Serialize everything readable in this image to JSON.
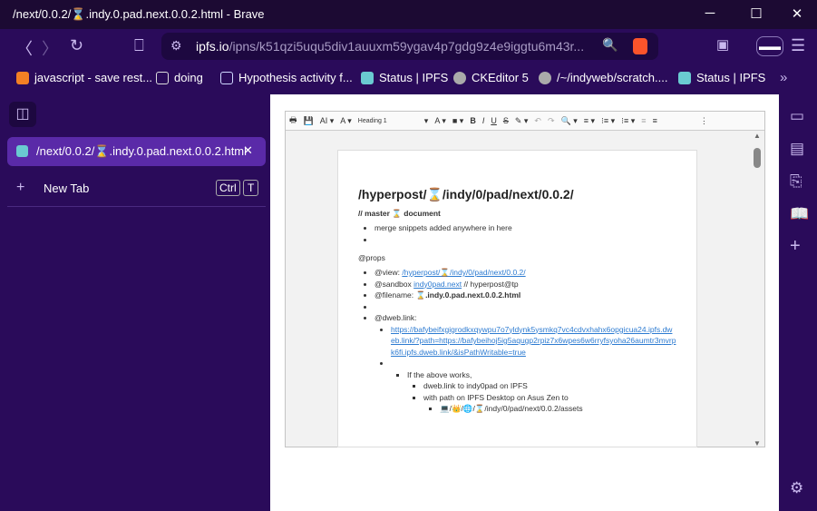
{
  "window": {
    "title": "/next/0.0.2/⌛.indy.0.pad.next.0.0.2.html - Brave",
    "min": "─",
    "max": "☐",
    "close": "✕"
  },
  "nav": {
    "url_host": "ipfs.io",
    "url_rest": "/ipns/k51qzi5uqu5div1auuxm59ygav4p7gdg9z4e9iggtu6m43r..."
  },
  "bookmarks": [
    {
      "label": "javascript - save rest...",
      "color": "#f48024"
    },
    {
      "label": "doing",
      "color": "transparent"
    },
    {
      "label": "Hypothesis activity f...",
      "color": "#cfd8ff"
    },
    {
      "label": "Status | IPFS",
      "color": "#6acad1"
    },
    {
      "label": "CKEditor 5",
      "color": "#aaa"
    },
    {
      "label": "/~/indyweb/scratch....",
      "color": "#aaa"
    },
    {
      "label": "Status | IPFS",
      "color": "#6acad1"
    }
  ],
  "bookmarks_more": "»",
  "sidebar": {
    "tab_title": "/next/0.0.2/⌛.indy.0.pad.next.0.0.2.html",
    "new_tab": "New Tab",
    "kbd1": "Ctrl",
    "kbd2": "T"
  },
  "toolbar": {
    "heading": "Heading 1"
  },
  "doc": {
    "title": "/hyperpost/⌛/indy/0/pad/next/0.0.2/",
    "subtitle": "// master ⌛ document",
    "item1": "merge snippets added anywhere in here",
    "props": "@props",
    "view_label": "@view: ",
    "view_link": "/hyperpost/⌛/indy/0/pad/next/0.0.2/",
    "sandbox_label": "@sandbox ",
    "sandbox_link": "indy0pad.next",
    "sandbox_rest": " // hyperpost@tp",
    "filename_label": "@filename: ",
    "filename": "⌛.indy.0.pad.next.0.0.2.html",
    "dweb": "@dweb.link:",
    "dweb_link": "https://bafybeifxgigrodkxqywpu7o7yldynk5ysmkq7vc4cdvxhahx6opgicua24.ipfs.dweb.link/?path=https://bafybeihoj5ig5aqugp2rpiz7x6wpes6w6rryfsyoha26aumtr3mvrpk6fi.ipfs.dweb.link/&isPathWritable=true",
    "works": "If the above works,",
    "sub1": "dweb.link to indy0pad on IPFS",
    "sub2": "with path on IPFS Desktop on Asus Zen to",
    "sub3": "💻/👑/🌐/⌛/indy/0/pad/next/0.0.2/assets"
  }
}
